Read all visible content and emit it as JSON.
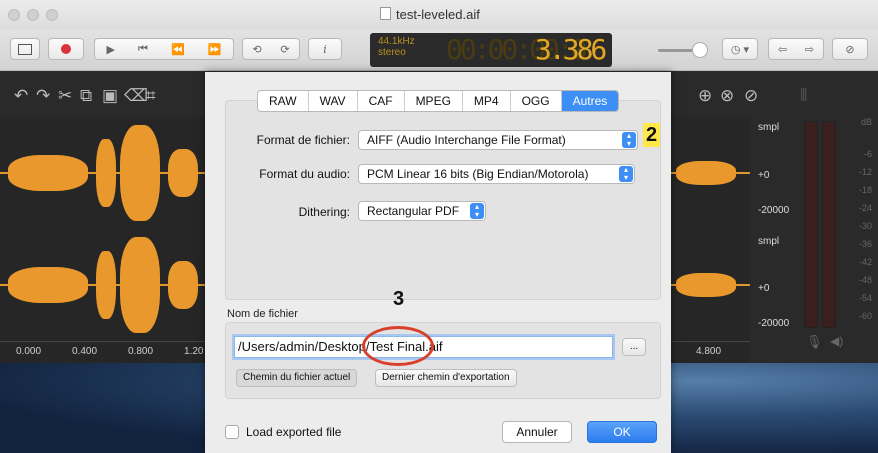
{
  "window": {
    "title": "test-leveled.aif"
  },
  "toolbar": {
    "lcd_rate": "44.1kHz",
    "lcd_channels": "stereo",
    "lcd_time_dim": "00:00:00:0",
    "lcd_time_lit": "3.386"
  },
  "waveform": {
    "ruler_labels": [
      "0.000",
      "0.400",
      "0.800",
      "1.20",
      "4.800"
    ],
    "scale_top": {
      "unit": "smpl",
      "zero": "+0",
      "low": "-20000"
    },
    "scale_bottom": {
      "unit": "smpl",
      "zero": "+0",
      "low": "-20000"
    },
    "db_labels": [
      "dB",
      "-6",
      "-12",
      "-18",
      "-24",
      "-30",
      "-36",
      "-42",
      "-48",
      "-54",
      "-60"
    ]
  },
  "dialog": {
    "tabs": [
      {
        "label": "RAW"
      },
      {
        "label": "WAV"
      },
      {
        "label": "CAF"
      },
      {
        "label": "MPEG"
      },
      {
        "label": "MP4"
      },
      {
        "label": "OGG"
      },
      {
        "label": "Autres",
        "active": true
      }
    ],
    "format_label": "Format de fichier:",
    "format_value": "AIFF (Audio Interchange File Format)",
    "audio_label": "Format du audio:",
    "audio_value": "PCM Linear 16 bits (Big Endian/Motorola)",
    "dither_label": "Dithering:",
    "dither_value": "Rectangular PDF",
    "filename_label": "Nom de fichier",
    "path_value": "/Users/admin/Desktop/Test Final.aif",
    "browse_label": "...",
    "current_path_button": "Chemin du fichier actuel",
    "last_export_button": "Dernier chemin d'exportation",
    "load_exported_label": "Load exported file",
    "cancel_button": "Annuler",
    "ok_button": "OK"
  },
  "annotations": {
    "marker_2": "2",
    "marker_3": "3"
  },
  "colors": {
    "accent": "#3d8ef5",
    "waveform": "#e5962a",
    "lcd": "#e5a823",
    "annotation": "#ffe94a",
    "circle": "#d9402b"
  }
}
